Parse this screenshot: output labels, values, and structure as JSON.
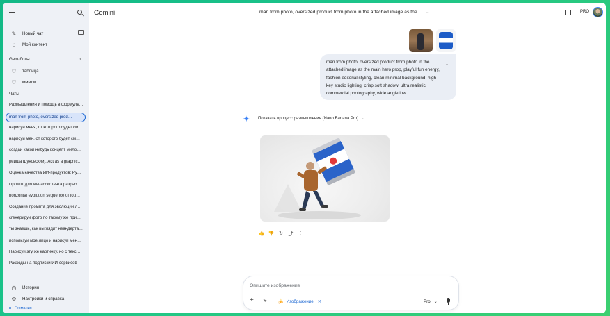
{
  "app": {
    "title": "Gemini"
  },
  "sidebar": {
    "new_chat": "Новый чат",
    "my_content": "Мой контент",
    "gems_label": "Gem-боты",
    "gems": [
      "таблица",
      "мммсм"
    ],
    "chats_label": "Чаты",
    "chats": [
      "Размышления и помощь в формуле…",
      "man from photo, oversized prod…",
      "нарисуй меня, от которого будет см…",
      "нарисуй мен, от которого будет см…",
      "создай какой нибудь концепт мило…",
      "[Миша Шуновский]. Act as a graphic…",
      "Оценка качества ИИ-продуктов: Ру…",
      "Промпт для ИИ-ассистента разраб…",
      "horizontal evolution sequence of fou…",
      "Создание промпта для эволюции л…",
      "сгенерируй фото по такому же при…",
      "ты знаешь, как выглядит неандерта…",
      "используй мое лицо и нарисуй мен…",
      "Нарисуй эту же картинку, но с текс…",
      "Расходы на подписки ИИ-сервисов"
    ],
    "active_chat_index": 1,
    "history": "История",
    "settings": "Настройки и справка",
    "country": "Германия"
  },
  "header": {
    "conversation_title": "man from photo, oversized product from photo in the attached image as the …",
    "pro_badge": "PRO"
  },
  "user_message": {
    "text": "man from photo, oversized product from photo in the attached image as the main hero prop, playful fun energy, fashion editorial styling, clean minimal background, high key studio lighting, crisp soft shadow, ultra realistic commercial photography, wide angle low…"
  },
  "response": {
    "thinking_label": "Показать процесс размышления (Nano Banana Pro)"
  },
  "composer": {
    "placeholder": "Опишите изображение",
    "chip_label": "Изображение",
    "model": "Pro"
  },
  "colors": {
    "accent": "#1a66d2",
    "sidebar_bg": "#eef1f6",
    "bubble_bg": "#eaeef5"
  }
}
